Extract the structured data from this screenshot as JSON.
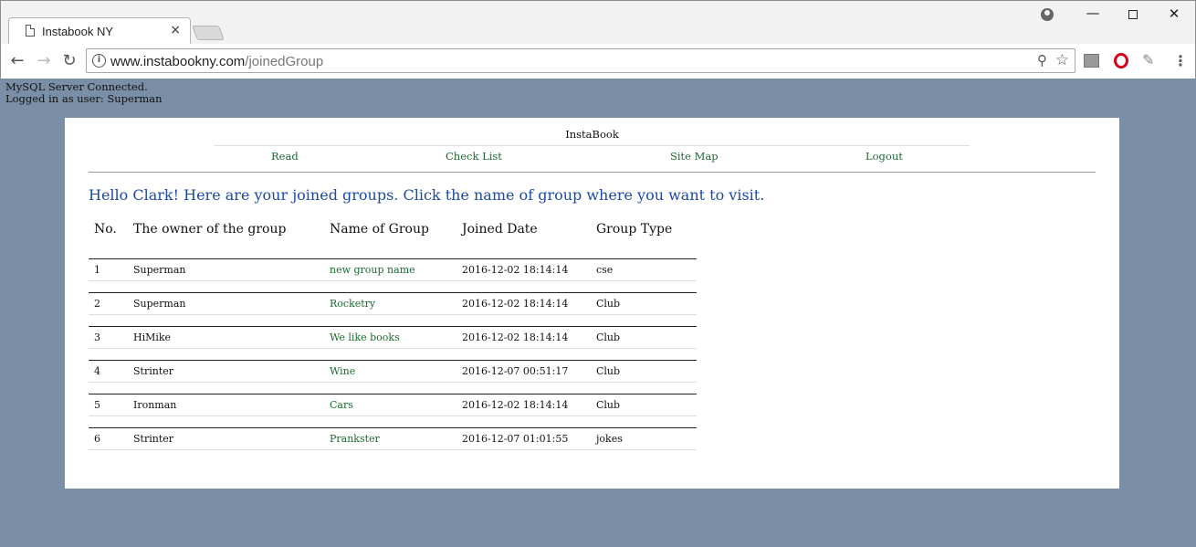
{
  "browser": {
    "tab_title": "Instabook NY",
    "tab_close": "×",
    "url_host": "www.instabookny.com",
    "url_path": "/joinedGroup",
    "window_controls": {
      "minimize": "—",
      "close": "✕"
    }
  },
  "status": {
    "line1": "MySQL Server Connected.",
    "line2": "Logged in as user: Superman"
  },
  "site": {
    "title": "InstaBook",
    "nav": [
      "Read",
      "Check List",
      "Site Map",
      "Logout"
    ]
  },
  "main": {
    "heading": "Hello Clark! Here are your joined groups. Click the name of group where you want to visit.",
    "columns": [
      "No.",
      "The owner of the group",
      "Name of Group",
      "Joined Date",
      "Group Type"
    ],
    "rows": [
      {
        "no": "1",
        "owner": "Superman",
        "name": "new group name",
        "date": "2016-12-02 18:14:14",
        "type": "cse"
      },
      {
        "no": "2",
        "owner": "Superman",
        "name": "Rocketry",
        "date": "2016-12-02 18:14:14",
        "type": "Club"
      },
      {
        "no": "3",
        "owner": "HiMike",
        "name": "We like books",
        "date": "2016-12-02 18:14:14",
        "type": "Club"
      },
      {
        "no": "4",
        "owner": "Strinter",
        "name": "Wine",
        "date": "2016-12-07 00:51:17",
        "type": "Club"
      },
      {
        "no": "5",
        "owner": "Ironman",
        "name": "Cars",
        "date": "2016-12-02 18:14:14",
        "type": "Club"
      },
      {
        "no": "6",
        "owner": "Strinter",
        "name": "Prankster",
        "date": "2016-12-07 01:01:55",
        "type": "jokes"
      }
    ]
  },
  "colors": {
    "page_bg": "#7a8fa6",
    "link": "#1a6b2f",
    "heading": "#1c4aa3"
  }
}
